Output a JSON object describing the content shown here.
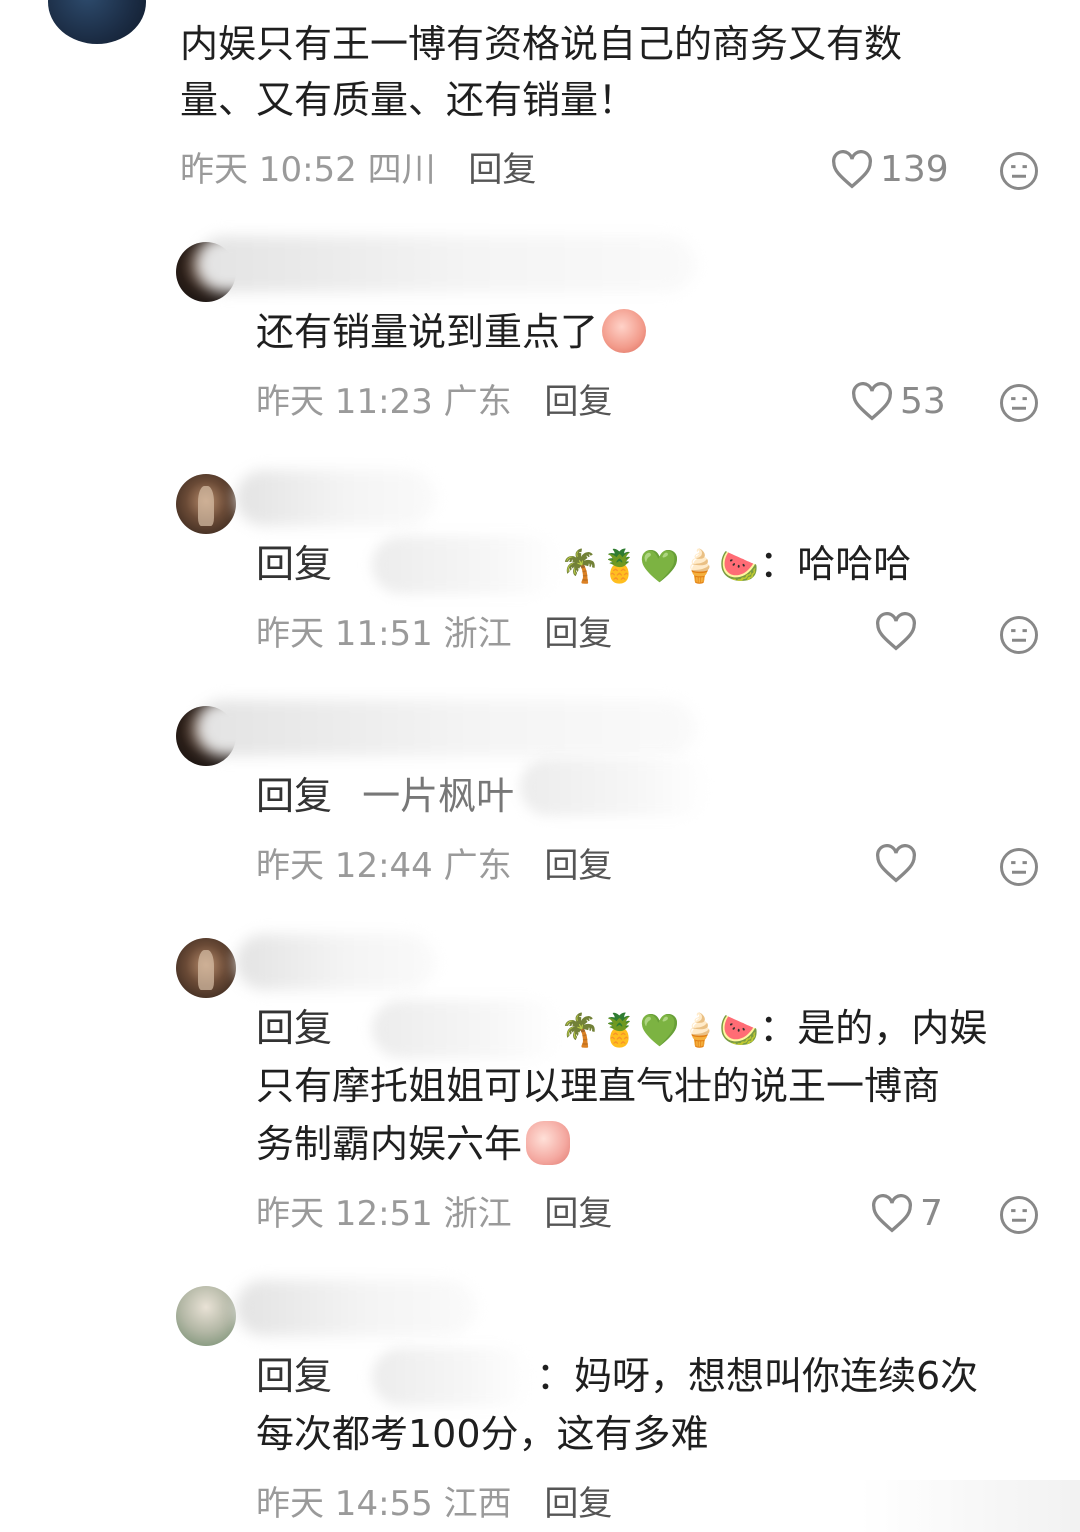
{
  "comments": [
    {
      "text_line1": "内娱只有王一博有资格说自己的商务又有数",
      "text_line2": "量、又有质量、还有销量！",
      "time": "昨天 10:52",
      "location": "四川",
      "reply_label": "回复",
      "likes": "139"
    },
    {
      "text": "还有销量说到重点了",
      "time": "昨天 11:23",
      "location": "广东",
      "reply_label": "回复",
      "likes": "53"
    },
    {
      "reply_prefix": "回复",
      "emojis": "🌴🍍💚🍦🍉",
      "colon_text": "：哈哈哈",
      "time": "昨天 11:51",
      "location": "浙江",
      "reply_label": "回复",
      "likes": ""
    },
    {
      "reply_prefix": "回复",
      "partial_name": "一片枫叶",
      "time": "昨天 12:44",
      "location": "广东",
      "reply_label": "回复",
      "likes": ""
    },
    {
      "reply_prefix": "回复",
      "emojis": "🌴🍍💚🍦🍉",
      "colon_text": "：是的，内娱",
      "text_line2": "只有摩托姐姐可以理直气壮的说王一博商",
      "text_line3": "务制霸内娱六年",
      "time": "昨天 12:51",
      "location": "浙江",
      "reply_label": "回复",
      "likes": "7"
    },
    {
      "reply_prefix": "回复",
      "colon_text": "：妈呀，想想叫你连续6次",
      "text_line2": "每次都考100分，这有多难",
      "time": "昨天 14:55",
      "location": "江西",
      "reply_label": "回复"
    }
  ],
  "icons": {
    "like": "heart-outline-icon",
    "dislike": "meh-face-icon"
  }
}
